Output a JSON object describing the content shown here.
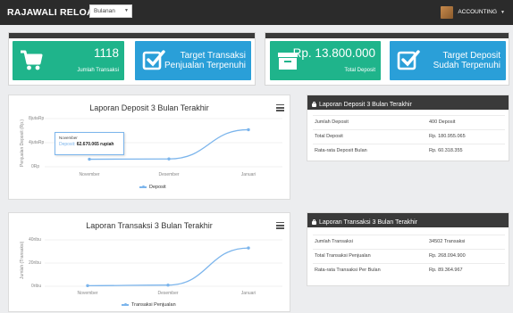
{
  "topbar": {
    "brand": "RAJAWALI RELOAD",
    "period_select": "Bulanan",
    "user_name": "ACCOUNTING"
  },
  "tiles": {
    "transactions": {
      "value": "1118",
      "label": "Jumlah Transaksi"
    },
    "target_sales": {
      "line1": "Target Transaksi",
      "line2": "Penjualan Terpenuhi"
    },
    "deposit": {
      "value": "Rp. 13.800.000",
      "label": "Total Deposit"
    },
    "target_deposit": {
      "line1": "Target Deposit",
      "line2": "Sudah Terpenuhi"
    }
  },
  "colors": {
    "green": "#1fb48b",
    "blue": "#2a9fd8",
    "dark": "#2b2b2b",
    "series": "#7cb5ec"
  },
  "deposit_chart": {
    "title": "Laporan Deposit 3 Bulan Terakhir",
    "ylabel": "Penjualan Deposit (Rp.)",
    "yticks": [
      "8jutaRp",
      "4jutaRp",
      "0Rp"
    ],
    "legend": "Deposit",
    "tooltip": {
      "head": "November",
      "series": "Deposit:",
      "value": "62.670.065 rupiah"
    }
  },
  "transaction_chart": {
    "title": "Laporan Transaksi 3 Bulan Terakhir",
    "ylabel": "Jumlah (Transaksi)",
    "yticks": [
      "40ribu",
      "20ribu",
      "0ribu"
    ],
    "legend": "Transaksi Penjualan"
  },
  "chart_data": [
    {
      "type": "line",
      "title": "Laporan Deposit 3 Bulan Terakhir",
      "ylabel": "Penjualan Deposit (Rp.)",
      "categories": [
        "November",
        "Desember",
        "Januari"
      ],
      "series": [
        {
          "name": "Deposit",
          "values": [
            62670065,
            65000000,
            308000000
          ]
        }
      ],
      "ytick_labels": [
        "8jutaRp",
        "4jutaRp",
        "0Rp"
      ],
      "legend": "bottom-center"
    },
    {
      "type": "line",
      "title": "Laporan Transaksi 3 Bulan Terakhir",
      "ylabel": "Jumlah (Transaksi)",
      "categories": [
        "November",
        "Desember",
        "Januari"
      ],
      "series": [
        {
          "name": "Transaksi Penjualan",
          "values": [
            500,
            1000,
            33000
          ]
        }
      ],
      "ylim": [
        0,
        40000
      ],
      "ytick_labels": [
        "40ribu",
        "20ribu",
        "0ribu"
      ],
      "legend": "bottom-center"
    }
  ],
  "deposit_summary": {
    "title": "Laporan Deposit 3 Bulan Terakhir",
    "rows": [
      {
        "label": "Jumlah Deposit",
        "value": "400 Deposit"
      },
      {
        "label": "Total Deposit",
        "value": "Rp. 180.955.065"
      },
      {
        "label": "Rata-rata Deposit Bulan",
        "value": "Rp. 60.318.355"
      }
    ]
  },
  "transaction_summary": {
    "title": "Laporan Transaksi 3 Bulan Terakhir",
    "rows": [
      {
        "label": "Jumlah Transaksi",
        "value": "34502 Transaksi"
      },
      {
        "label": "Total Transaksi Penjualan",
        "value": "Rp. 268.094.900"
      },
      {
        "label": "Rata-rata Transaksi Per Bulan",
        "value": "Rp. 89.364.967"
      }
    ]
  }
}
